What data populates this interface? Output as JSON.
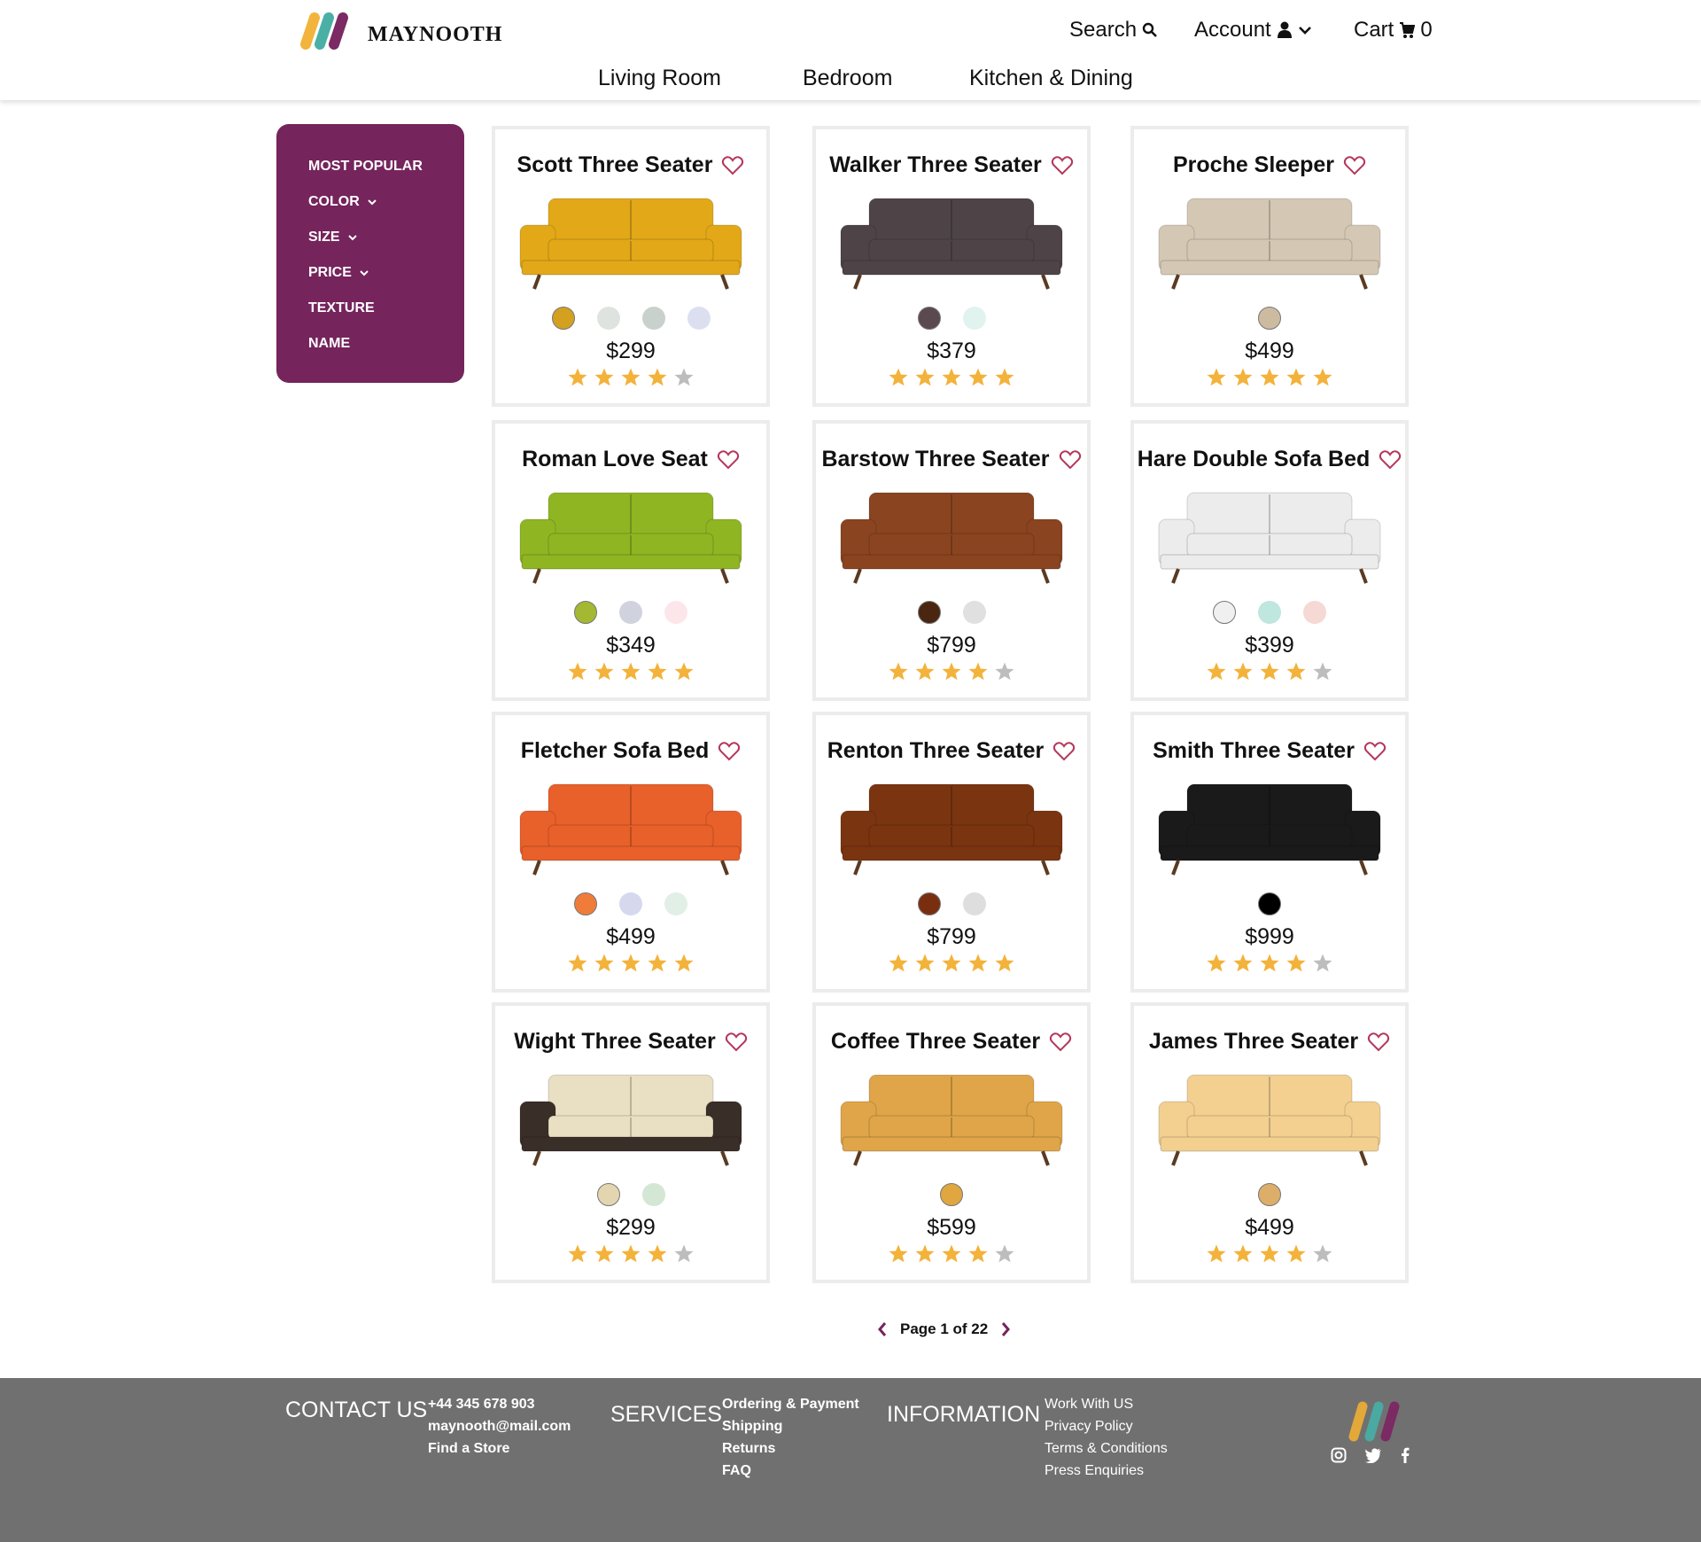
{
  "header": {
    "brand": "MAYNOOTH",
    "search_label": "Search",
    "account_label": "Account",
    "cart_label": "Cart",
    "cart_count": "0",
    "nav": [
      "Living Room",
      "Bedroom",
      "Kitchen & Dining"
    ]
  },
  "sidebar": {
    "items": [
      {
        "label": "MOST POPULAR",
        "dropdown": false
      },
      {
        "label": "COLOR",
        "dropdown": true
      },
      {
        "label": "SIZE",
        "dropdown": true
      },
      {
        "label": "PRICE",
        "dropdown": true
      },
      {
        "label": "TEXTURE",
        "dropdown": false
      },
      {
        "label": "NAME",
        "dropdown": false
      }
    ]
  },
  "colors": {
    "brand_purple": "#75245c",
    "star": "#f3b23a",
    "star_empty": "#bdbdbd",
    "heart": "#b5375c",
    "footer_bg": "#707070"
  },
  "products": [
    {
      "name": "Scott Three Seater",
      "price": "$299",
      "rating": 4,
      "sofa_color": "#e2a818",
      "swatches": [
        "#d4a020",
        "#dfe3df",
        "#c9d1cc",
        "#dcdff0"
      ]
    },
    {
      "name": "Walker Three Seater",
      "price": "$379",
      "rating": 5,
      "sofa_color": "#4e4448",
      "swatches": [
        "#5a4a50",
        "#e0f3ee"
      ]
    },
    {
      "name": "Proche Sleeper",
      "price": "$499",
      "rating": 5,
      "sofa_color": "#d4c8b4",
      "swatches": [
        "#cdbba0"
      ]
    },
    {
      "name": "Roman Love Seat",
      "price": "$349",
      "rating": 5,
      "sofa_color": "#8fb522",
      "swatches": [
        "#a4b832",
        "#d0d3dd",
        "#fde6ea"
      ]
    },
    {
      "name": "Barstow Three Seater",
      "price": "$799",
      "rating": 4,
      "sofa_color": "#8a4420",
      "swatches": [
        "#4a2510",
        "#e0e0e0"
      ]
    },
    {
      "name": "Hare Double Sofa Bed",
      "price": "$399",
      "rating": 4,
      "sofa_color": "#ececec",
      "swatches": [
        "#f0f0f0",
        "#bfe6df",
        "#f6d8d4"
      ]
    },
    {
      "name": "Fletcher Sofa Bed",
      "price": "$499",
      "rating": 5,
      "sofa_color": "#e8602a",
      "swatches": [
        "#f07c3a",
        "#d6d9ee",
        "#e1efe6"
      ]
    },
    {
      "name": "Renton Three Seater",
      "price": "$799",
      "rating": 5,
      "sofa_color": "#7a3410",
      "swatches": [
        "#7a2e10",
        "#dedede"
      ]
    },
    {
      "name": "Smith Three Seater",
      "price": "$999",
      "rating": 4,
      "sofa_color": "#1a1a1a",
      "swatches": [
        "#000000"
      ]
    },
    {
      "name": "Wight Three Seater",
      "price": "$299",
      "rating": 4,
      "sofa_color": "#e9dfc2",
      "swatches": [
        "#e3d5b0",
        "#d4e6d4"
      ]
    },
    {
      "name": "Coffee Three Seater",
      "price": "$599",
      "rating": 4,
      "sofa_color": "#dfa548",
      "swatches": [
        "#e0a640"
      ]
    },
    {
      "name": "James Three Seater",
      "price": "$499",
      "rating": 4,
      "sofa_color": "#f3d090",
      "swatches": [
        "#dcae6a"
      ]
    }
  ],
  "pagination": {
    "label": "Page 1 of 22"
  },
  "footer": {
    "contact": {
      "title": "CONTACT US",
      "items": [
        "+44 345 678 903",
        "maynooth@mail.com",
        "Find a Store"
      ]
    },
    "services": {
      "title": "SERVICES",
      "items": [
        "Ordering & Payment",
        "Shipping",
        "Returns",
        "FAQ"
      ]
    },
    "information": {
      "title": "INFORMATION",
      "items": [
        "Work With US",
        "Privacy Policy",
        "Terms & Conditions",
        "Press Enquiries"
      ]
    },
    "social": [
      "instagram-icon",
      "twitter-icon",
      "facebook-icon"
    ]
  }
}
